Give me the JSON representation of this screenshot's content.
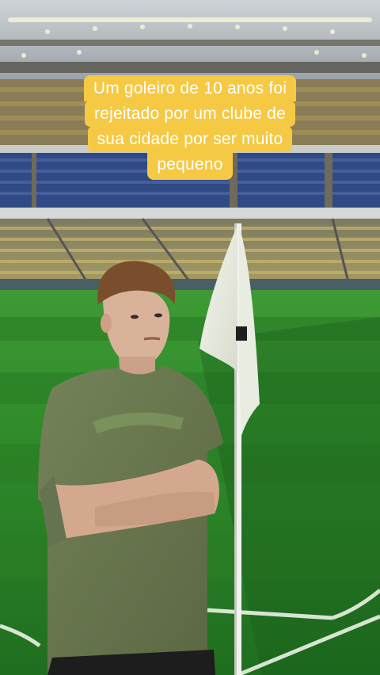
{
  "caption": {
    "lines": [
      "Um goleiro de 10 anos foi",
      "rejeitado por um clube de",
      "sua cidade por ser muito",
      "pequeno"
    ],
    "background_color": "#f6c945",
    "text_color": "#ffffff"
  },
  "scene": {
    "description_tags": [
      "stadium-background",
      "football-pitch",
      "corner-flag",
      "person-arms-crossed"
    ],
    "pitch_color": "#2f8f2c",
    "shirt_color": "#6b7a4c"
  }
}
